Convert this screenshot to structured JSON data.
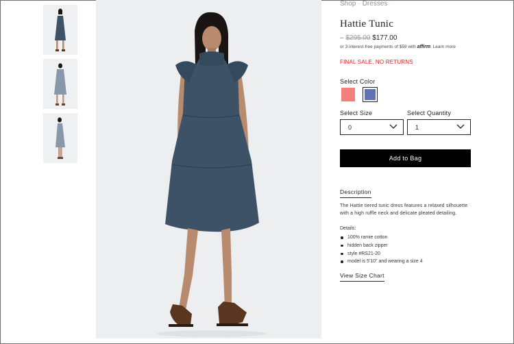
{
  "breadcrumb": {
    "items": [
      "Shop",
      "Dresses"
    ]
  },
  "product": {
    "title": "Hattie Tunic",
    "price_dash": "–",
    "original_price": "$295.00",
    "sale_price": "$177.00",
    "installments_prefix": "or 3 interest-free payments of $59 with",
    "affirm_label": "affirm",
    "learn_more": "Learn more",
    "final_sale": "FINAL SALE, NO RETURNS"
  },
  "color": {
    "label": "Select Color",
    "swatches": [
      {
        "name": "Coral",
        "hex": "#f27f7a"
      },
      {
        "name": "Blue",
        "hex": "#5f73b4",
        "selected": true
      }
    ]
  },
  "size": {
    "label": "Select Size",
    "value": "0"
  },
  "quantity": {
    "label": "Select Quantity",
    "value": "1"
  },
  "add_to_bag": "Add to Bag",
  "description": {
    "tab_label": "Description",
    "text": "The Hattie tiered tunic dress features a relaxed silhouette with a high ruffle neck and delicate pleated detailing.",
    "details_label": "Details:",
    "details": [
      "100% ramie cotton",
      "hidden back zipper",
      "style #RS21-20",
      "model is 5'10\" and wearing a size 4"
    ]
  },
  "size_chart": "View Size Chart",
  "colors": {
    "dress": "#3d5266",
    "skin": "#b88a6e",
    "hair": "#1a1512",
    "background": "#eceef0"
  }
}
